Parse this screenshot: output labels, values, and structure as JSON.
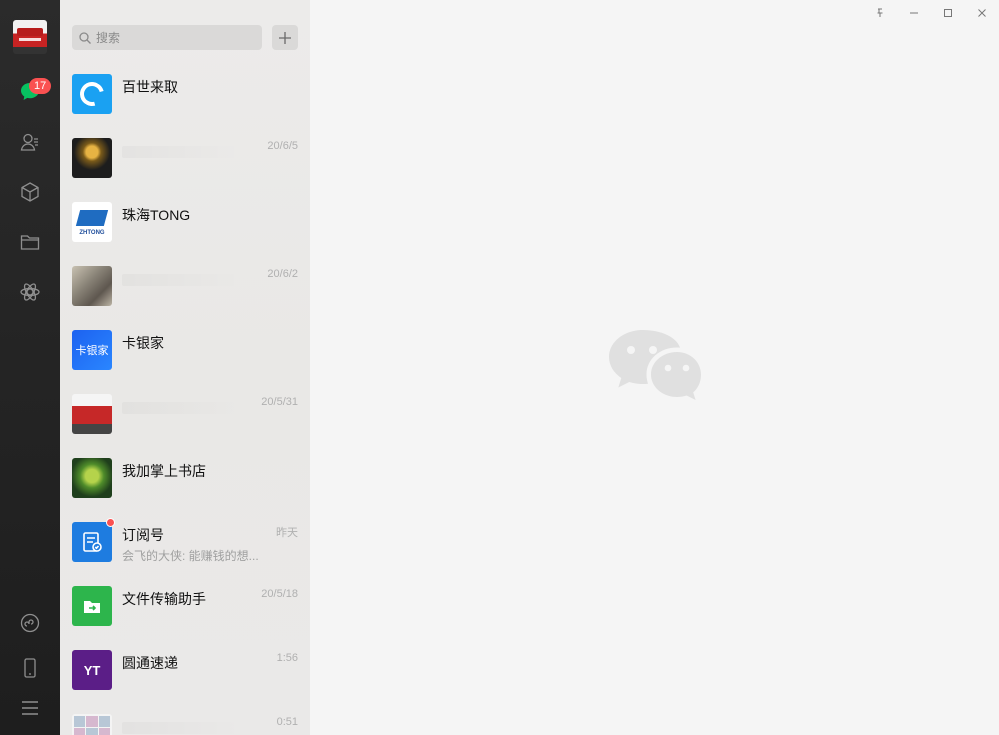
{
  "app": {
    "accent": "#07c160",
    "badge_color": "#fa5151"
  },
  "rail": {
    "unread_badge": "17",
    "items": [
      {
        "icon": "chat-icon"
      },
      {
        "icon": "contacts-icon"
      },
      {
        "icon": "favorites-icon"
      },
      {
        "icon": "files-icon"
      },
      {
        "icon": "moments-icon"
      },
      {
        "icon": "miniprogram-icon"
      },
      {
        "icon": "phone-icon"
      },
      {
        "icon": "menu-icon"
      }
    ]
  },
  "search": {
    "placeholder": "搜索"
  },
  "chats": [
    {
      "name": "百世来取",
      "time": "",
      "preview": ""
    },
    {
      "name": "",
      "time": "20/6/5",
      "preview": ""
    },
    {
      "name": "珠海TONG",
      "time": "",
      "preview": ""
    },
    {
      "name": "",
      "time": "20/6/2",
      "preview": ""
    },
    {
      "name": "卡银家",
      "time": "",
      "preview": ""
    },
    {
      "name": "",
      "time": "20/5/31",
      "preview": ""
    },
    {
      "name": "我加掌上书店",
      "time": "",
      "preview": ""
    },
    {
      "name": "订阅号",
      "time": "昨天",
      "preview": "会飞的大侠: 能赚钱的想..."
    },
    {
      "name": "文件传输助手",
      "time": "20/5/18",
      "preview": ""
    },
    {
      "name": "圆通速递",
      "time": "1:56",
      "preview": ""
    },
    {
      "name": "",
      "time": "0:51",
      "preview": ""
    }
  ],
  "thumb_texts": {
    "zhtong": "ZHTONG",
    "kayin": "卡银家",
    "yto": "YT"
  }
}
